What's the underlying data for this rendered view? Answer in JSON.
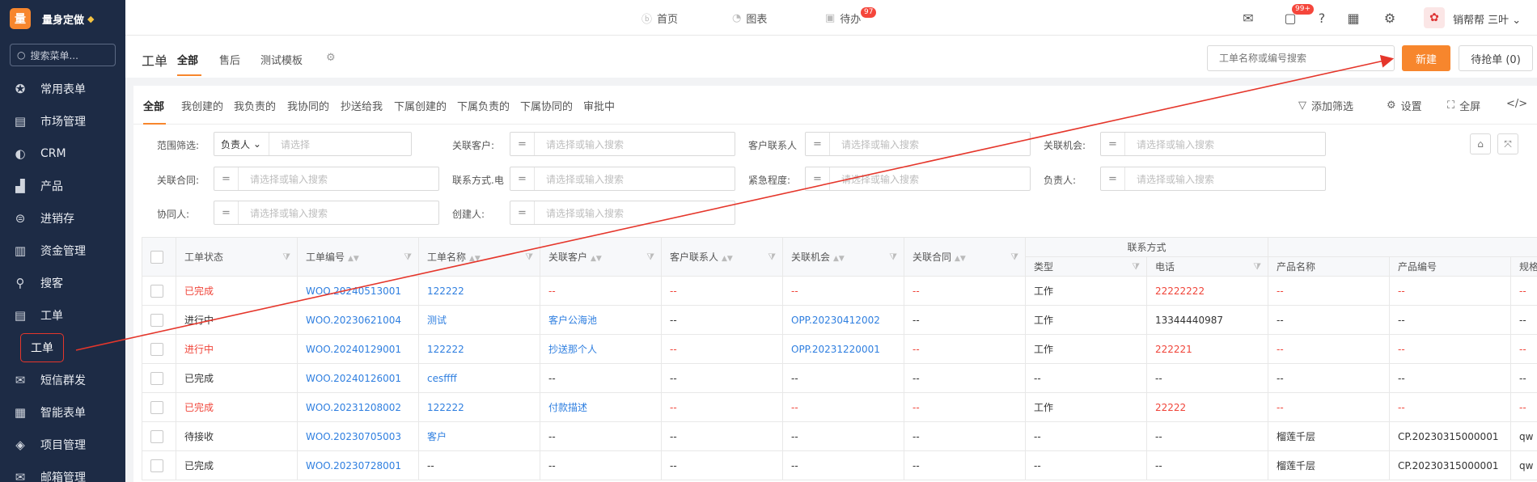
{
  "sidebar": {
    "logo_badge": "量",
    "logo_text": "量身定做",
    "search_placeholder": "搜索菜单...",
    "items": [
      {
        "label": "常用表单",
        "icon": "star-icon"
      },
      {
        "label": "市场管理",
        "icon": "clipboard-icon"
      },
      {
        "label": "CRM",
        "icon": "pie-icon"
      },
      {
        "label": "产品",
        "icon": "product-icon"
      },
      {
        "label": "进销存",
        "icon": "inventory-icon"
      },
      {
        "label": "资金管理",
        "icon": "finance-icon"
      },
      {
        "label": "搜客",
        "icon": "search-icon"
      },
      {
        "label": "工单",
        "icon": "workorder-icon"
      }
    ],
    "sub_item": "工单",
    "items2": [
      {
        "label": "短信群发",
        "icon": "mail-icon"
      },
      {
        "label": "智能表单",
        "icon": "form-icon"
      },
      {
        "label": "项目管理",
        "icon": "layers-icon"
      },
      {
        "label": "邮箱管理",
        "icon": "mailbox-icon"
      }
    ]
  },
  "topbar": {
    "nav": [
      {
        "label": "首页",
        "icon": "home-icon"
      },
      {
        "label": "图表",
        "icon": "chart-icon"
      },
      {
        "label": "待办",
        "icon": "todo-icon",
        "badge": "97"
      }
    ],
    "message_badge": "99+",
    "username": "销帮帮 三叶"
  },
  "pagehead": {
    "title": "工单",
    "tabs": [
      "全部",
      "售后",
      "测试模板"
    ],
    "search_placeholder": "工单名称或编号搜索",
    "new_button": "新建",
    "grab_button": "待抢单 (0)"
  },
  "filter_tabs": [
    "全部",
    "我创建的",
    "我负责的",
    "我协同的",
    "抄送给我",
    "下属创建的",
    "下属负责的",
    "下属协同的",
    "审批中"
  ],
  "filter_actions": {
    "add_filter": "添加筛选",
    "settings": "设置",
    "fullscreen": "全屏"
  },
  "filters": {
    "scope_label": "范围筛选:",
    "scope_select": "负责人",
    "scope_placeholder": "请选择",
    "customer_label": "关联客户:",
    "contact_label": "客户联系人",
    "opportunity_label": "关联机会:",
    "contract_label": "关联合同:",
    "method_label": "联系方式.电",
    "urgency_label": "紧急程度:",
    "owner_label": "负责人:",
    "collab_label": "协同人:",
    "creator_label": "创建人:",
    "placeholder": "请选择或输入搜索"
  },
  "table": {
    "headers": {
      "status": "工单状态",
      "number": "工单编号",
      "name": "工单名称",
      "customer": "关联客户",
      "contact": "客户联系人",
      "opportunity": "关联机会",
      "contract": "关联合同",
      "group": "联系方式",
      "type": "类型",
      "phone": "电话",
      "product_name": "产品名称",
      "product_no": "产品编号",
      "spec": "规格"
    },
    "rows": [
      {
        "status": "已完成",
        "number": "WOO.20240513001",
        "name": "122222",
        "customer": "--",
        "contact": "--",
        "opportunity": "--",
        "contract": "--",
        "type": "工作",
        "phone": "22222222",
        "product_name": "--",
        "product_no": "--",
        "spec": "--",
        "red": true
      },
      {
        "status": "进行中",
        "number": "WOO.20230621004",
        "name": "测试",
        "customer": "客户公海池",
        "contact": "--",
        "opportunity": "OPP.20230412002",
        "contract": "--",
        "type": "工作",
        "phone": "13344440987",
        "product_name": "--",
        "product_no": "--",
        "spec": "--",
        "red": false
      },
      {
        "status": "进行中",
        "number": "WOO.20240129001",
        "name": "122222",
        "customer": "抄送那个人",
        "contact": "--",
        "opportunity": "OPP.20231220001",
        "contract": "--",
        "type": "工作",
        "phone": "222221",
        "product_name": "--",
        "product_no": "--",
        "spec": "--",
        "red": true
      },
      {
        "status": "已完成",
        "number": "WOO.20240126001",
        "name": "cesffff",
        "customer": "--",
        "contact": "--",
        "opportunity": "--",
        "contract": "--",
        "type": "--",
        "phone": "--",
        "product_name": "--",
        "product_no": "--",
        "spec": "--",
        "red": false
      },
      {
        "status": "已完成",
        "number": "WOO.20231208002",
        "name": "122222",
        "customer": "付款描述",
        "contact": "--",
        "opportunity": "--",
        "contract": "--",
        "type": "工作",
        "phone": "22222",
        "product_name": "--",
        "product_no": "--",
        "spec": "--",
        "red": true
      },
      {
        "status": "待接收",
        "number": "WOO.20230705003",
        "name": "客户",
        "customer": "--",
        "contact": "--",
        "opportunity": "--",
        "contract": "--",
        "type": "--",
        "phone": "--",
        "product_name": "榴莲千层",
        "product_no": "CP.20230315000001",
        "spec": "qw",
        "red": false
      },
      {
        "status": "已完成",
        "number": "WOO.20230728001",
        "name": "--",
        "customer": "--",
        "contact": "--",
        "opportunity": "--",
        "contract": "--",
        "type": "--",
        "phone": "--",
        "product_name": "榴莲千层",
        "product_no": "CP.20230315000001",
        "spec": "qw",
        "red": false
      }
    ]
  },
  "colors": {
    "accent": "#f7862d",
    "sidebar": "#1d2b45",
    "red": "#f0453a",
    "blue": "#2f7fe0",
    "annotation": "#e5362b"
  }
}
